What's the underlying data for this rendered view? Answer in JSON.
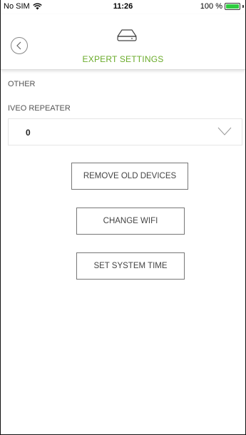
{
  "status_bar": {
    "carrier": "No SIM",
    "time": "11:26",
    "battery_text": "100 %",
    "battery_level": 1.0,
    "battery_color": "#2ecc40"
  },
  "header": {
    "back_icon": "chevron-left-circle-icon",
    "device_icon": "router-device-icon",
    "title": "EXPERT SETTINGS",
    "title_color": "#6aab2a"
  },
  "content": {
    "section_title": "OTHER",
    "repeater": {
      "label": "IVEO REPEATER",
      "selected_value": "0",
      "dropdown_icon": "chevron-down-icon"
    },
    "buttons": {
      "remove_old_devices": "REMOVE OLD DEVICES",
      "change_wifi": "CHANGE WIFI",
      "set_system_time": "SET SYSTEM TIME"
    }
  }
}
